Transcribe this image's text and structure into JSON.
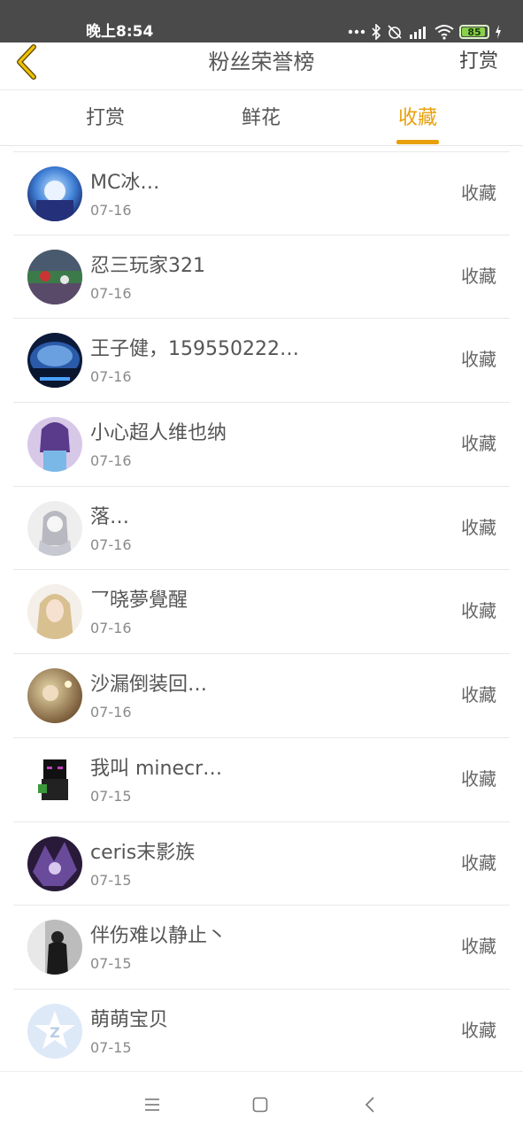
{
  "status": {
    "time": "晚上8:54",
    "battery": "85",
    "battery_level": 0.85,
    "icons": [
      "more-dots-icon",
      "bluetooth-icon",
      "alarm-off-icon",
      "hd-signal-icon",
      "wifi-icon",
      "battery-icon",
      "charging-icon"
    ]
  },
  "header": {
    "title": "粉丝荣誉榜",
    "action_label": "打赏"
  },
  "tabs": [
    {
      "label": "打赏",
      "active": false
    },
    {
      "label": "鲜花",
      "active": false
    },
    {
      "label": "收藏",
      "active": true
    }
  ],
  "list": [
    {
      "name": "MC冰…",
      "date": "07-16",
      "action": "收藏"
    },
    {
      "name": "忍三玩家321",
      "date": "07-16",
      "action": "收藏"
    },
    {
      "name": "王子健，159550222…",
      "date": "07-16",
      "action": "收藏"
    },
    {
      "name": "小心超人维也纳",
      "date": "07-16",
      "action": "收藏"
    },
    {
      "name": "落…",
      "date": "07-16",
      "action": "收藏"
    },
    {
      "name": "乛晓夢覺醒",
      "date": "07-16",
      "action": "收藏"
    },
    {
      "name": "沙漏倒装回…",
      "date": "07-16",
      "action": "收藏"
    },
    {
      "name": "我叫 minecr…",
      "date": "07-15",
      "action": "收藏"
    },
    {
      "name": "ceris末影族",
      "date": "07-15",
      "action": "收藏"
    },
    {
      "name": "伴伤难以静止丶",
      "date": "07-15",
      "action": "收藏"
    },
    {
      "name": "萌萌宝贝",
      "date": "07-15",
      "action": "收藏"
    }
  ],
  "colors": {
    "accent": "#e8a10b",
    "status_bar": "#4a4a4a",
    "text": "#555555",
    "muted": "#8a8a8a"
  },
  "nav": [
    "menu-icon",
    "home-square-icon",
    "back-chevron-icon"
  ]
}
